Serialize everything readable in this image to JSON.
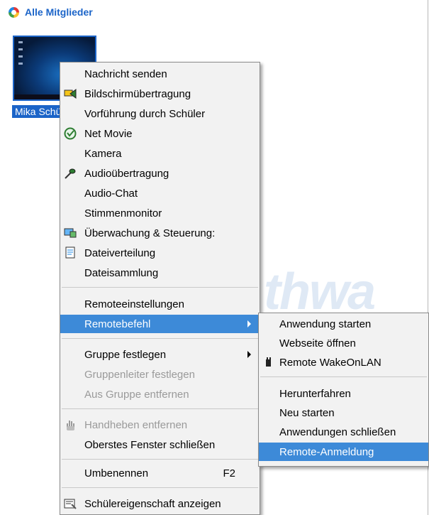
{
  "header": {
    "title": "Alle Mitglieder"
  },
  "student": {
    "caption": "Mika Schüler"
  },
  "watermark": "thwa",
  "context_menu": {
    "items": [
      {
        "label": "Nachricht senden",
        "icon": ""
      },
      {
        "label": "Bildschirmübertragung",
        "icon": "screen-broadcast-icon"
      },
      {
        "label": "Vorführung durch Schüler",
        "icon": ""
      },
      {
        "label": "Net Movie",
        "icon": "net-movie-icon"
      },
      {
        "label": "Kamera",
        "icon": ""
      },
      {
        "label": "Audioübertragung",
        "icon": "microphone-icon"
      },
      {
        "label": "Audio-Chat",
        "icon": ""
      },
      {
        "label": "Stimmenmonitor",
        "icon": ""
      },
      {
        "label": "Überwachung & Steuerung:",
        "icon": "monitor-control-icon"
      },
      {
        "label": "Dateiverteilung",
        "icon": "file-distribution-icon"
      },
      {
        "label": "Dateisammlung",
        "icon": ""
      },
      {
        "label": "Remoteeinstellungen",
        "icon": ""
      },
      {
        "label": "Remotebefehl",
        "icon": "",
        "highlighted": true,
        "submenu": true
      },
      {
        "label": "Gruppe festlegen",
        "icon": "",
        "submenu": true
      },
      {
        "label": "Gruppenleiter festlegen",
        "icon": "",
        "disabled": true
      },
      {
        "label": "Aus Gruppe entfernen",
        "icon": "",
        "disabled": true
      },
      {
        "label": "Handheben entfernen",
        "icon": "hand-raise-icon",
        "disabled": true
      },
      {
        "label": "Oberstes Fenster schließen",
        "icon": ""
      },
      {
        "label": "Umbenennen",
        "icon": "",
        "accelerator": "F2"
      },
      {
        "label": "Schülereigenschaft anzeigen",
        "icon": "properties-icon"
      }
    ]
  },
  "submenu": {
    "items": [
      {
        "label": "Anwendung starten",
        "icon": ""
      },
      {
        "label": "Webseite öffnen",
        "icon": ""
      },
      {
        "label": "Remote WakeOnLAN",
        "icon": "power-plug-icon"
      },
      {
        "label": "Herunterfahren",
        "icon": ""
      },
      {
        "label": "Neu starten",
        "icon": ""
      },
      {
        "label": "Anwendungen schließen",
        "icon": ""
      },
      {
        "label": "Remote-Anmeldung",
        "icon": "",
        "highlighted": true
      }
    ]
  },
  "colors": {
    "highlight": "#3d8ad8",
    "title_blue": "#1b64c8",
    "menu_bg": "#f2f2f2",
    "disabled": "#9a9a9a"
  }
}
